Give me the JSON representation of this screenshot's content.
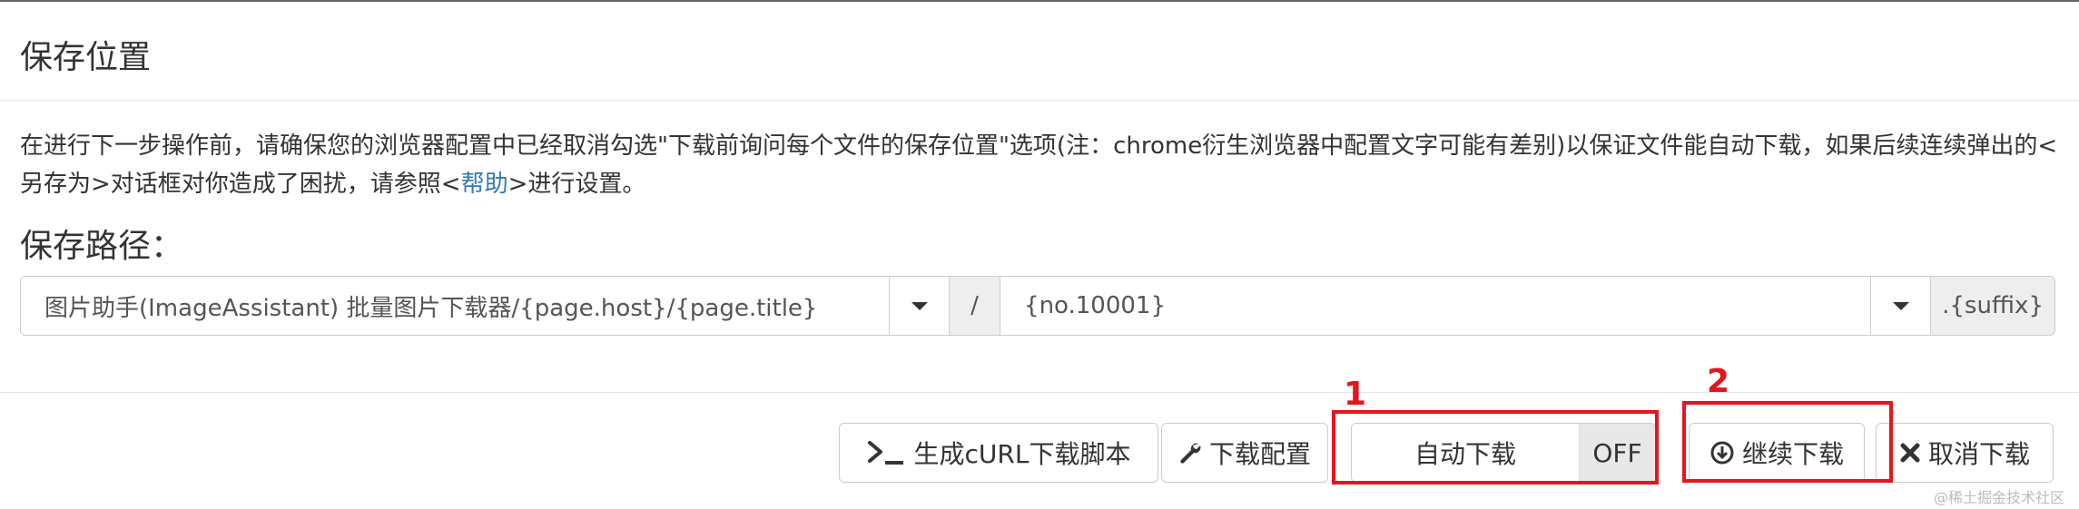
{
  "dialog": {
    "title": "保存位置",
    "notice_before": "在进行下一步操作前，请确保您的浏览器配置中已经取消勾选\"下载前询问每个文件的保存位置\"选项(注：chrome衍生浏览器中配置文字可能有差别)以保证文件能自动下载，如果后续连续弹出的<另存为>对话框对你造成了困扰，请参照<",
    "notice_link": "帮助",
    "notice_after": ">进行设置。",
    "path_label": "保存路径："
  },
  "path": {
    "folder_value": "图片助手(ImageAssistant) 批量图片下载器/{page.host}/{page.title}",
    "separator": "/",
    "filename_value": "{no.10001}",
    "suffix": ".{suffix}"
  },
  "buttons": {
    "curl_label": "生成cURL下载脚本",
    "config_label": "下载配置",
    "auto_label": "自动下载",
    "auto_state": "OFF",
    "continue_label": "继续下载",
    "cancel_label": "取消下载"
  },
  "annotations": {
    "marker_1": "1",
    "marker_2": "2",
    "color": "#e8141d"
  },
  "watermark": "@稀土掘金技术社区",
  "icons": {
    "curl": "terminal-icon",
    "config": "wrench-icon",
    "continue": "download-circle-icon",
    "cancel": "close-icon",
    "dropdown": "caret-down-icon"
  }
}
